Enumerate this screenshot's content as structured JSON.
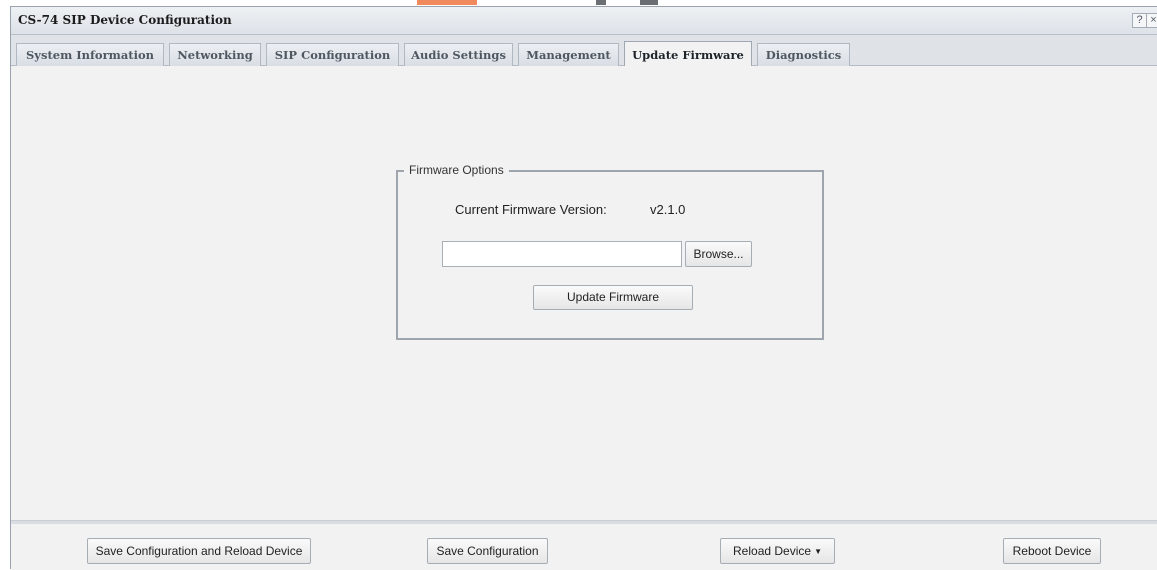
{
  "window": {
    "title": "CS-74 SIP Device Configuration",
    "help_icon": "?",
    "close_icon": "×"
  },
  "tabs": [
    {
      "label": "System Information",
      "active": false
    },
    {
      "label": "Networking",
      "active": false
    },
    {
      "label": "SIP Configuration",
      "active": false
    },
    {
      "label": "Audio Settings",
      "active": false
    },
    {
      "label": "Management",
      "active": false
    },
    {
      "label": "Update Firmware",
      "active": true
    },
    {
      "label": "Diagnostics",
      "active": false
    }
  ],
  "firmware": {
    "legend": "Firmware Options",
    "current_label": "Current Firmware Version:",
    "current_value": "v2.1.0",
    "file_value": "",
    "browse_label": "Browse...",
    "update_label": "Update Firmware"
  },
  "footer": {
    "save_reload_label": "Save Configuration and Reload Device",
    "save_label": "Save Configuration",
    "reload_label": "Reload Device",
    "reload_caret": "▼",
    "reboot_label": "Reboot Device"
  },
  "colors": {
    "accent_strip": "#e8612c",
    "dark_strip": "#55595e"
  }
}
